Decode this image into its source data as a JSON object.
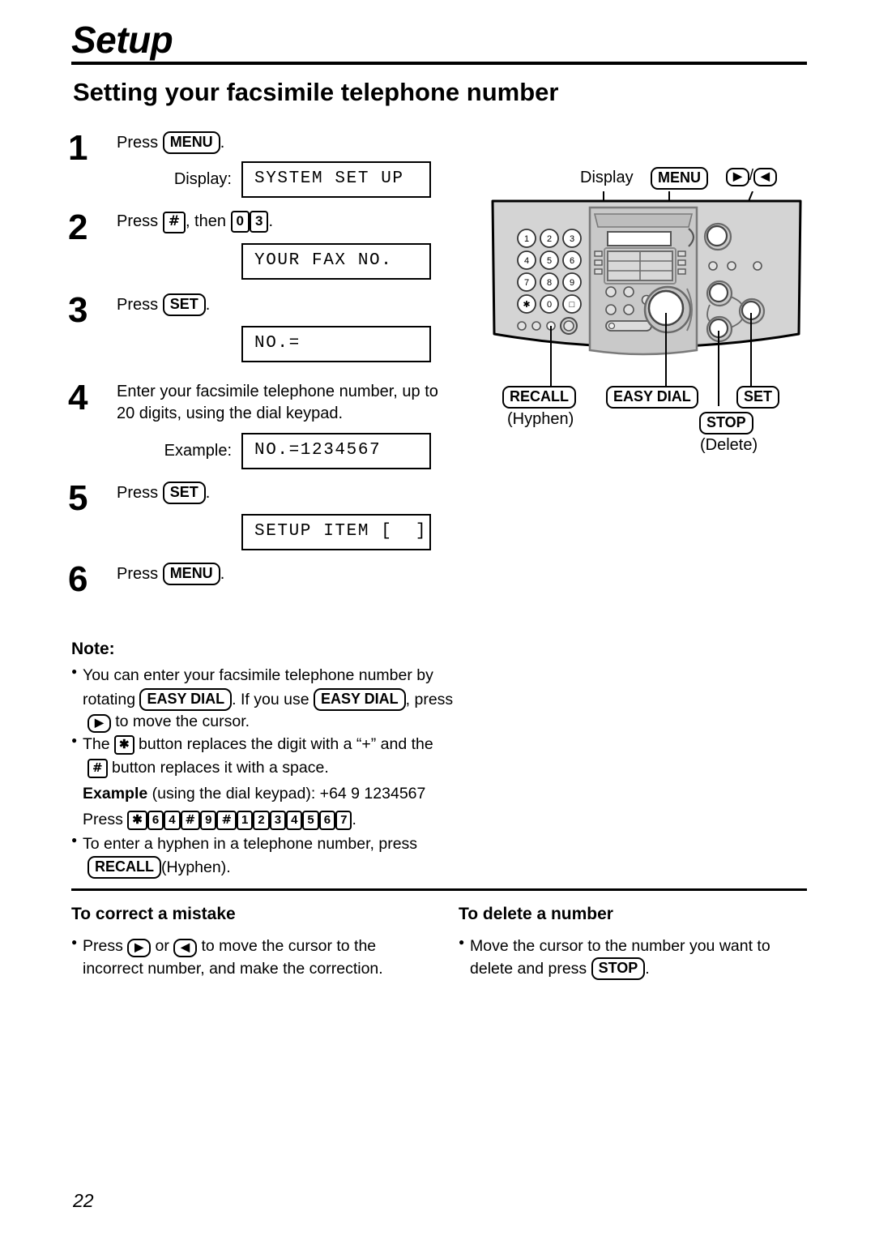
{
  "header": {
    "chapter": "Setup",
    "title": "Setting your facsimile telephone number"
  },
  "steps": [
    {
      "num": "1",
      "text_before": "Press",
      "key": "MENU",
      "text_after": ".",
      "display_label": "Display:",
      "lcd": "SYSTEM SET UP"
    },
    {
      "num": "2",
      "text_before": "Press",
      "key1": "#",
      "mid": ", then",
      "key2": "0",
      "key3": "3",
      "text_after": ".",
      "lcd": "YOUR FAX NO."
    },
    {
      "num": "3",
      "text_before": "Press",
      "key": "SET",
      "text_after": ".",
      "lcd": "NO.="
    },
    {
      "num": "4",
      "line1": "Enter your facsimile telephone number, up to",
      "line2": "20 digits, using the dial keypad.",
      "display_label": "Example:",
      "lcd": "NO.=1234567"
    },
    {
      "num": "5",
      "text_before": "Press",
      "key": "SET",
      "text_after": ".",
      "lcd": "SETUP ITEM [  ]"
    },
    {
      "num": "6",
      "text_before": "Press",
      "key": "MENU",
      "text_after": "."
    }
  ],
  "note": {
    "heading": "Note:",
    "b1_part1": "You can enter your facsimile telephone number by",
    "b1_part2_pre": "rotating",
    "b1_key1": "EASY DIAL",
    "b1_part2_mid": ". If you use",
    "b1_key2": "EASY DIAL",
    "b1_part2_post": ", press",
    "b1_part3_key": "▶",
    "b1_part3": "to move the cursor.",
    "b2_pre": "The",
    "b2_key1": "✱",
    "b2_mid": "button replaces the digit with a “+” and the",
    "b2_key2": "#",
    "b2_post": "button replaces it with a space.",
    "example_bold": "Example",
    "example_rest": "(using the dial keypad):  +64 9 1234567",
    "press_label": "Press",
    "press_keys": [
      "✱",
      "6",
      "4",
      "#",
      "9",
      "#",
      "1",
      "2",
      "3",
      "4",
      "5",
      "6",
      "7"
    ],
    "press_period": ".",
    "b3_line1": "To enter a hyphen in a telephone number, press",
    "b3_key": "RECALL",
    "b3_line2": "(Hyphen)."
  },
  "bottom": {
    "left": {
      "heading": "To correct a mistake",
      "pre": "Press",
      "key1": "▶",
      "mid": "or",
      "key2": "◀",
      "post": "to move the cursor to the",
      "line2": "incorrect number, and make the correction."
    },
    "right": {
      "heading": "To delete a number",
      "line1": "Move the cursor to the number you want to",
      "line2_pre": "delete and press",
      "key": "STOP",
      "line2_post": "."
    }
  },
  "diagram": {
    "label_display": "Display",
    "key_menu": "MENU",
    "key_right_arrow": "▶",
    "slash": "/",
    "key_left_arrow": "◀",
    "key_recall": "RECALL",
    "recall_sub": "(Hyphen)",
    "key_easy_dial": "EASY DIAL",
    "key_stop": "STOP",
    "stop_sub": "(Delete)",
    "key_set": "SET",
    "keypad": [
      "1",
      "2",
      "3",
      "4",
      "5",
      "6",
      "7",
      "8",
      "9",
      "✱",
      "0",
      "□"
    ]
  },
  "page_number": "22"
}
